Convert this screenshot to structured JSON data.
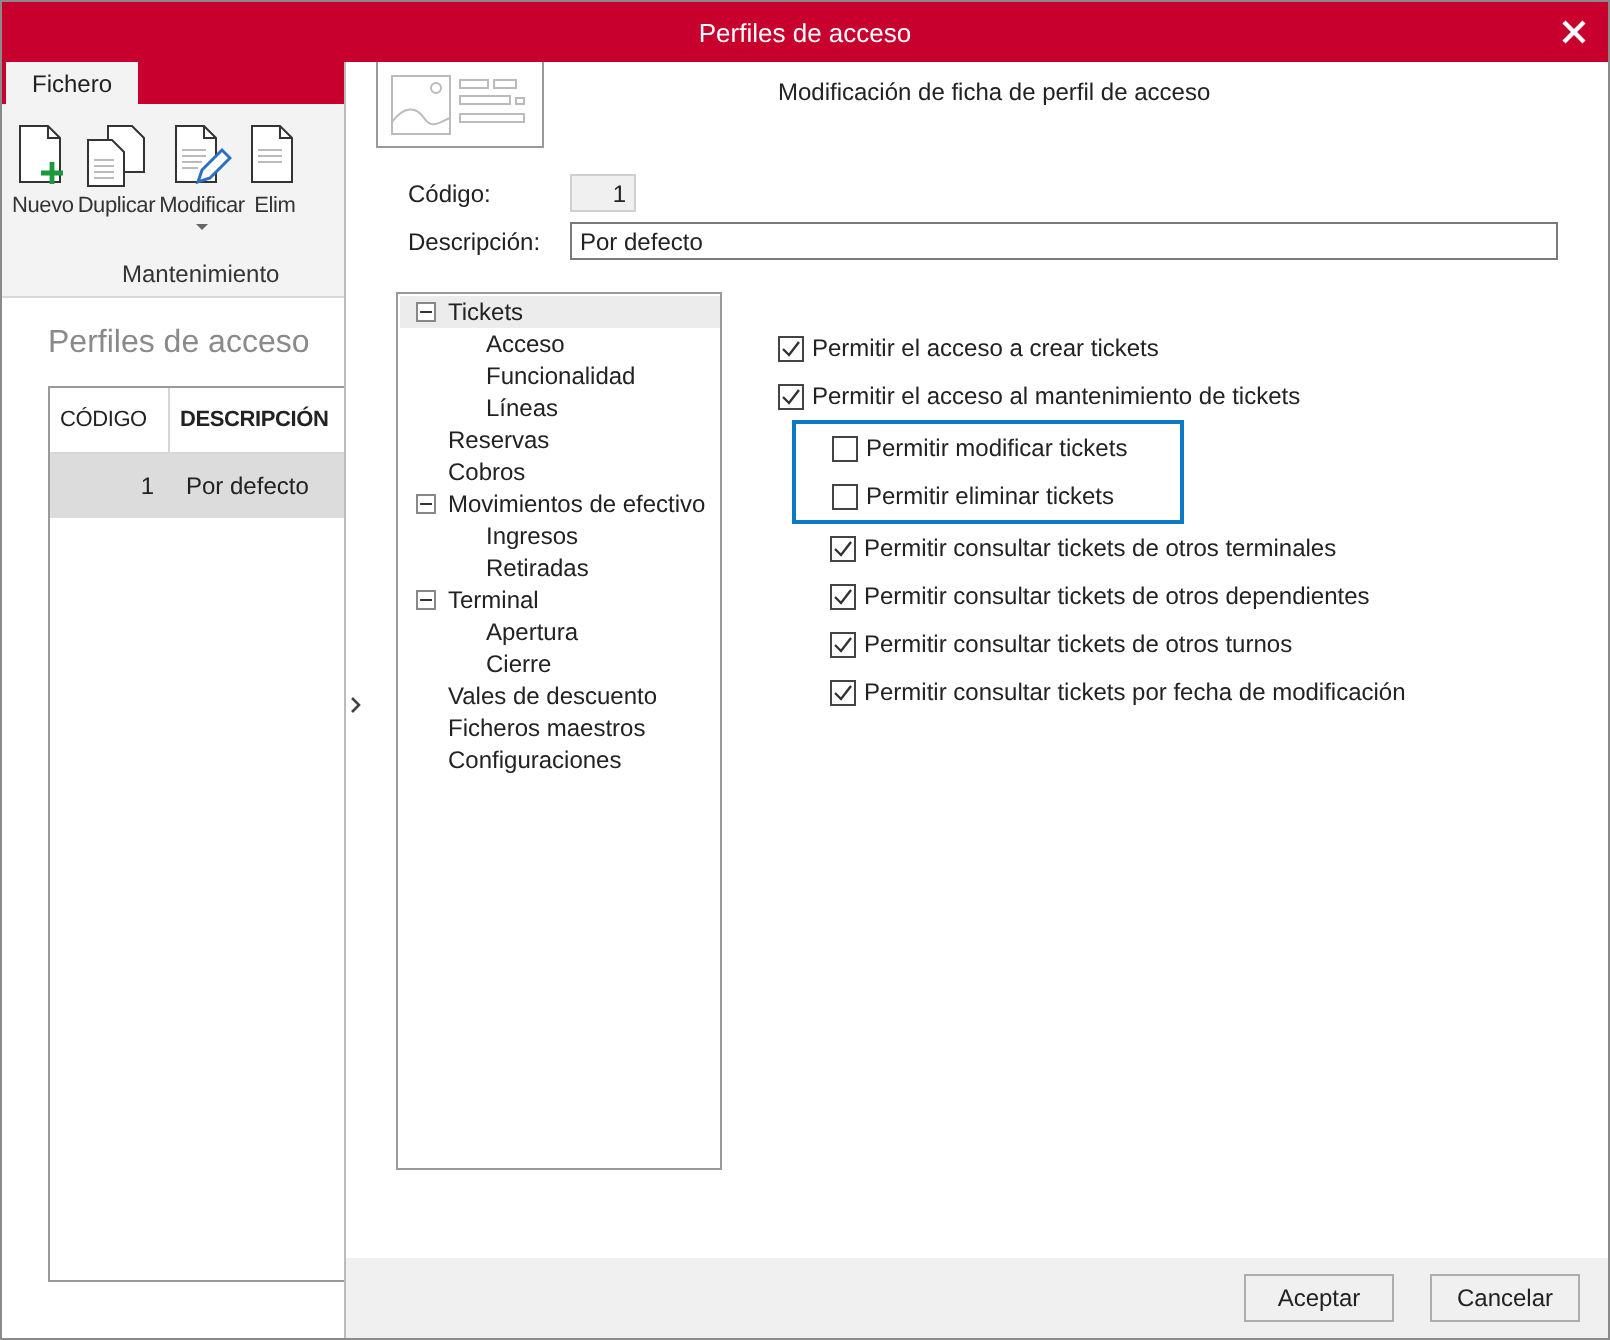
{
  "window": {
    "title": "Perfiles de acceso"
  },
  "ribbon": {
    "tabs": [
      {
        "label": "Fichero",
        "selected": true
      }
    ],
    "buttons": [
      {
        "label": "Nuevo",
        "kind": "new",
        "dropdown": false
      },
      {
        "label": "Duplicar",
        "kind": "duplicate",
        "dropdown": false
      },
      {
        "label": "Modificar",
        "kind": "edit",
        "dropdown": true
      },
      {
        "label": "Elim",
        "kind": "delete",
        "dropdown": false
      }
    ],
    "group": "Mantenimiento"
  },
  "list": {
    "heading": "Perfiles de acceso",
    "columns": [
      {
        "label": "CÓDIGO",
        "sorted": false
      },
      {
        "label": "DESCRIPCIÓN",
        "sorted": true
      }
    ],
    "rows": [
      {
        "cells": [
          "1",
          "Por defecto"
        ],
        "selected": true
      }
    ]
  },
  "dialog": {
    "subtitle": "Modificación de ficha de perfil de acceso",
    "fields": [
      {
        "label": "Código:",
        "value": "1",
        "kind": "code"
      },
      {
        "label": "Descripción:",
        "value": "Por defecto",
        "kind": "text"
      }
    ],
    "tree": [
      {
        "label": "Tickets",
        "expanded": true,
        "selected": true,
        "children": [
          {
            "label": "Acceso",
            "selected": false
          },
          {
            "label": "Funcionalidad",
            "selected": false
          },
          {
            "label": "Líneas",
            "selected": false
          }
        ]
      },
      {
        "label": "Reservas",
        "selected": false
      },
      {
        "label": "Cobros",
        "selected": false
      },
      {
        "label": "Movimientos de efectivo",
        "expanded": true,
        "selected": false,
        "children": [
          {
            "label": "Ingresos",
            "selected": false
          },
          {
            "label": "Retiradas",
            "selected": false
          }
        ]
      },
      {
        "label": "Terminal",
        "expanded": true,
        "selected": false,
        "children": [
          {
            "label": "Apertura",
            "selected": false
          },
          {
            "label": "Cierre",
            "selected": false
          }
        ]
      },
      {
        "label": "Vales de descuento",
        "selected": false
      },
      {
        "label": "Ficheros maestros",
        "selected": false
      },
      {
        "label": "Configuraciones",
        "selected": false
      }
    ],
    "permissions": [
      {
        "label": "Permitir el acceso a crear tickets",
        "checked": true
      },
      {
        "label": "Permitir el acceso al mantenimiento de tickets",
        "checked": true,
        "children": [
          {
            "label": "Permitir modificar tickets",
            "checked": false,
            "highlighted": true
          },
          {
            "label": "Permitir eliminar tickets",
            "checked": false,
            "highlighted": true
          },
          {
            "label": "Permitir consultar tickets de otros terminales",
            "checked": true,
            "highlighted": false
          },
          {
            "label": "Permitir consultar tickets de otros dependientes",
            "checked": true,
            "highlighted": false
          },
          {
            "label": "Permitir consultar tickets de otros turnos",
            "checked": true,
            "highlighted": false
          },
          {
            "label": "Permitir consultar tickets por fecha de modificación",
            "checked": true,
            "highlighted": false
          }
        ]
      }
    ],
    "buttons": [
      "Aceptar",
      "Cancelar"
    ]
  }
}
